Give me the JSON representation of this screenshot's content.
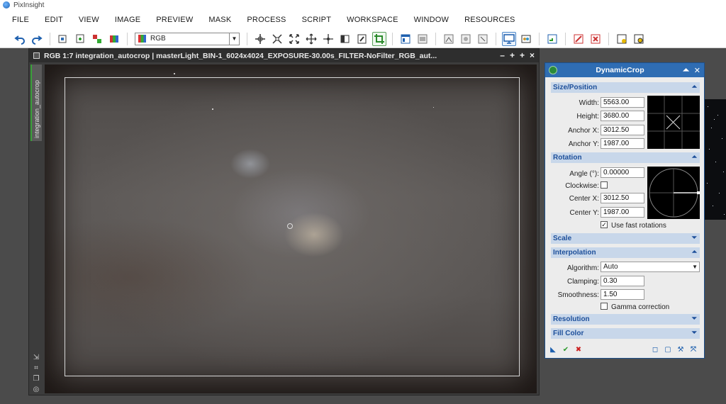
{
  "app": {
    "title": "PixInsight"
  },
  "menu": [
    "FILE",
    "EDIT",
    "VIEW",
    "IMAGE",
    "PREVIEW",
    "MASK",
    "PROCESS",
    "SCRIPT",
    "WORKSPACE",
    "WINDOW",
    "RESOURCES"
  ],
  "toolbar": {
    "channel_select": "RGB",
    "icons": [
      "undo-icon",
      "redo-icon",
      "new-instance-icon",
      "duplicate-icon",
      "swap-icon",
      "mask-icon"
    ]
  },
  "image_window": {
    "title": "RGB 1:7 integration_autocrop | masterLight_BIN-1_6024x4024_EXPOSURE-30.00s_FILTER-NoFilter_RGB_aut...",
    "side_tab": "integration_autocrop",
    "controls": [
      "–",
      "+",
      "+",
      "×"
    ]
  },
  "dynamic_crop": {
    "title": "DynamicCrop",
    "size_position": {
      "header": "Size/Position",
      "width_label": "Width:",
      "width": "5563.00",
      "height_label": "Height:",
      "height": "3680.00",
      "anchor_x_label": "Anchor X:",
      "anchor_x": "3012.50",
      "anchor_y_label": "Anchor Y:",
      "anchor_y": "1987.00"
    },
    "rotation": {
      "header": "Rotation",
      "angle_label": "Angle (°):",
      "angle": "0.00000",
      "clockwise_label": "Clockwise:",
      "center_x_label": "Center X:",
      "center_x": "3012.50",
      "center_y_label": "Center Y:",
      "center_y": "1987.00",
      "fast_rotations_label": "Use fast rotations",
      "fast_rotations_checked": "✓"
    },
    "scale": {
      "header": "Scale"
    },
    "interpolation": {
      "header": "Interpolation",
      "algorithm_label": "Algorithm:",
      "algorithm": "Auto",
      "clamping_label": "Clamping:",
      "clamping": "0.30",
      "smoothness_label": "Smoothness:",
      "smoothness": "1.50",
      "gamma_label": "Gamma correction"
    },
    "resolution": {
      "header": "Resolution"
    },
    "fill_color": {
      "header": "Fill Color"
    },
    "colors": {
      "header_bg": "#c8d7ea",
      "title_bg": "#2f6db3",
      "apply_green": "#2a9a2a",
      "cancel_red": "#cc2222"
    }
  }
}
